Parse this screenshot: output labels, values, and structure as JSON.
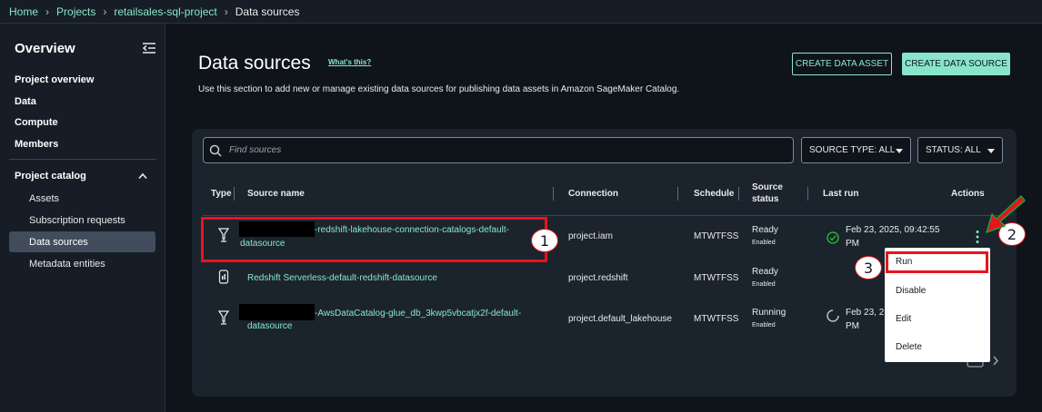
{
  "breadcrumb": {
    "items": [
      "Home",
      "Projects",
      "retailsales-sql-project"
    ],
    "current": "Data sources"
  },
  "sidebar": {
    "title": "Overview",
    "items": [
      "Project overview",
      "Data",
      "Compute",
      "Members"
    ],
    "section": "Project catalog",
    "sub_items": [
      "Assets",
      "Subscription requests",
      "Data sources",
      "Metadata entities"
    ],
    "active": "Data sources"
  },
  "header": {
    "title": "Data sources",
    "whats_this": "What's this?",
    "description": "Use this section to add new or manage existing data sources for publishing data assets in Amazon SageMaker Catalog.",
    "create_asset": "CREATE DATA ASSET",
    "create_source": "CREATE DATA SOURCE"
  },
  "filters": {
    "search_placeholder": "Find sources",
    "source_type": "SOURCE TYPE: ALL",
    "status": "STATUS: ALL"
  },
  "table": {
    "columns": [
      "Type",
      "Source name",
      "Connection",
      "Schedule",
      "Source",
      "status",
      "Last run",
      "Actions"
    ],
    "rows": [
      {
        "name_line1": "-redshift-lakehouse-connection-catalogs-default-",
        "name_line2": "datasource",
        "connection": "project.iam",
        "schedule": "MTWTFSS",
        "status": "Ready",
        "status_sub": "Enabled",
        "last_run_line1": "Feb 23, 2025, 09:42:55",
        "last_run_line2": "PM",
        "type_icon": "lakehouse-icon"
      },
      {
        "name_line1": "Redshift Serverless-default-redshift-datasource",
        "connection": "project.redshift",
        "schedule": "MTWTFSS",
        "status": "Ready",
        "status_sub": "Enabled",
        "type_icon": "redshift-icon"
      },
      {
        "name_line1": "-AwsDataCatalog-glue_db_3kwp5vbcatjx2f-default-",
        "name_line2": "datasource",
        "connection": "project.default_lakehouse",
        "schedule": "MTWTFSS",
        "status": "Running",
        "status_sub": "Enabled",
        "last_run_line1": "Feb 23, 2",
        "last_run_line2": "PM",
        "type_icon": "lakehouse-icon"
      }
    ]
  },
  "actions_menu": [
    "Run",
    "Disable",
    "Edit",
    "Delete"
  ],
  "callouts": [
    "1",
    "2",
    "3"
  ],
  "colors": {
    "accent": "#89e5c9",
    "annotation": "#e8141b",
    "success": "#29ad32"
  }
}
